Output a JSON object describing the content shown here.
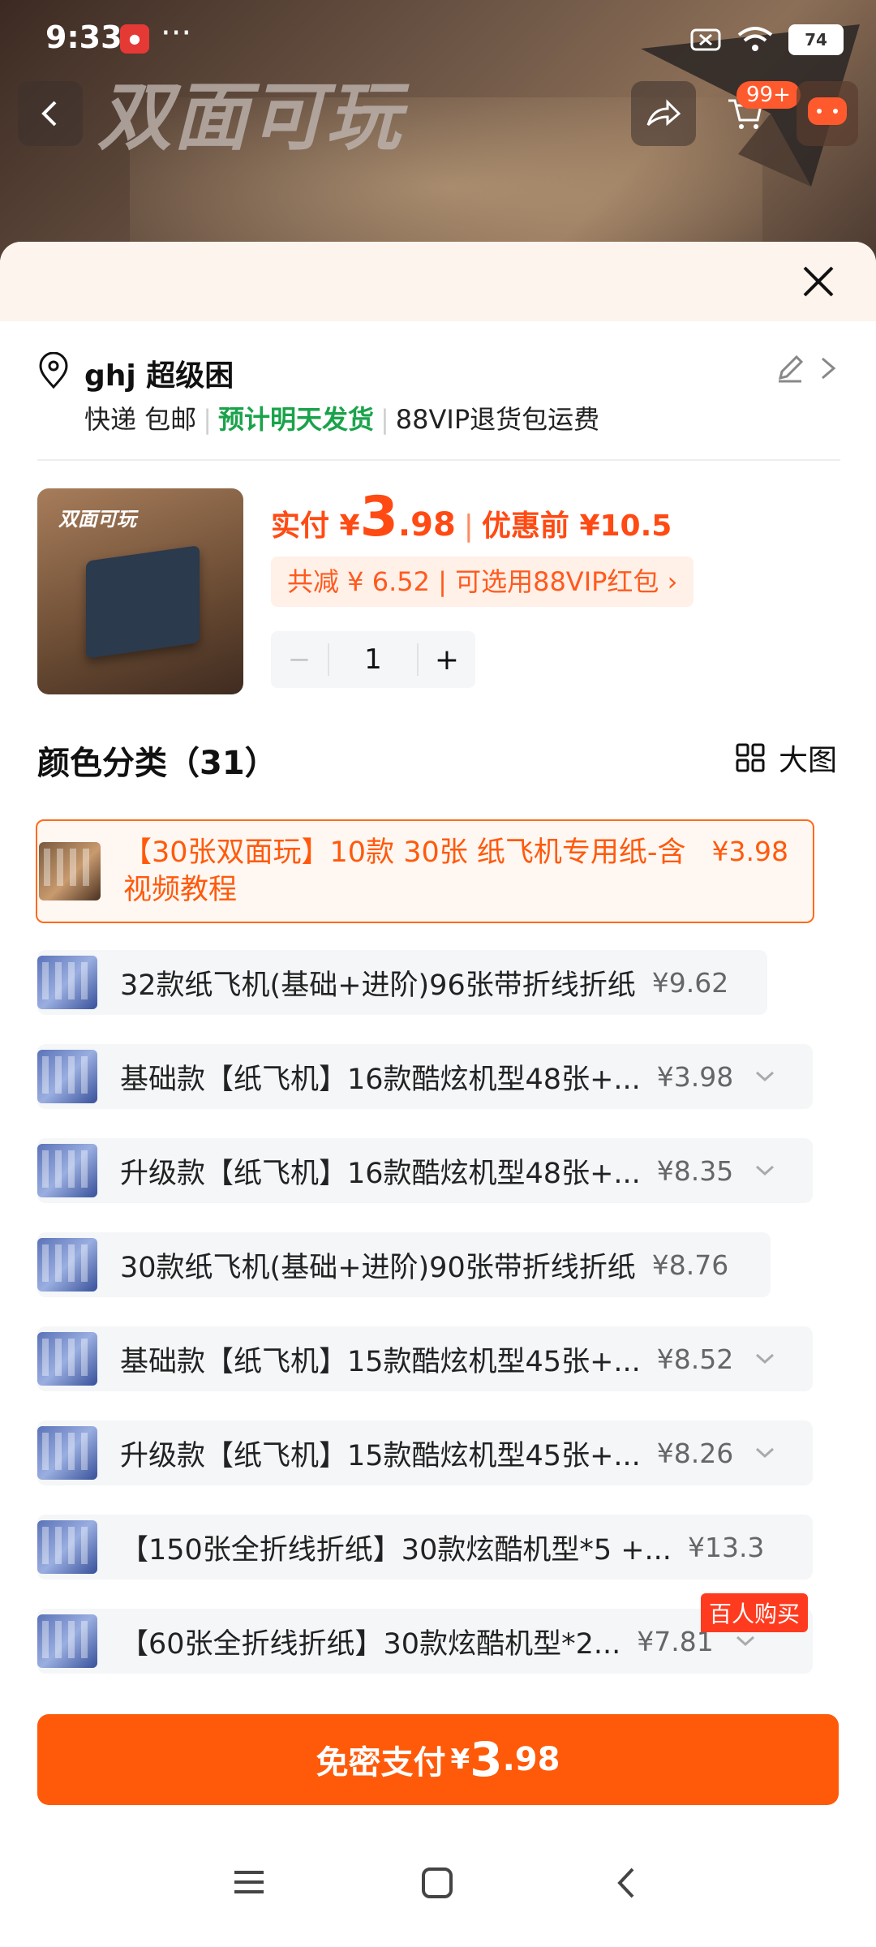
{
  "status_bar": {
    "time": "9:33",
    "more": "···",
    "battery": "74"
  },
  "hero": {
    "title": "双面可玩"
  },
  "top_nav": {
    "cart_badge": "99+"
  },
  "address": {
    "name": "ghj 超级困",
    "shipping": "快递 包邮",
    "ship_time": "预计明天发货",
    "return_note": "88VIP退货包运费"
  },
  "product": {
    "img_tag": "双面可玩",
    "paid_label": "实付 ¥",
    "price_int": "3",
    "price_dec": ".98",
    "before_label": "优惠前 ¥10.5",
    "discount_text": "共减 ¥ 6.52 | 可选用88VIP红包 ›",
    "quantity": "1",
    "minus": "−",
    "plus": "+"
  },
  "section": {
    "title": "颜色分类（31）",
    "big_image": "大图"
  },
  "options": [
    {
      "label": "【30张双面玩】10款 30张 纸飞机专用纸-含视频教程",
      "price": "¥3.98"
    },
    {
      "label": "32款纸飞机(基础+进阶)96张带折线折纸",
      "price": "¥9.62"
    },
    {
      "label": "基础款【纸飞机】16款酷炫机型48张+...",
      "price": "¥3.98"
    },
    {
      "label": "升级款【纸飞机】16款酷炫机型48张+...",
      "price": "¥8.35"
    },
    {
      "label": "30款纸飞机(基础+进阶)90张带折线折纸",
      "price": "¥8.76"
    },
    {
      "label": "基础款【纸飞机】15款酷炫机型45张+...",
      "price": "¥8.52"
    },
    {
      "label": "升级款【纸飞机】15款酷炫机型45张+...",
      "price": "¥8.26"
    },
    {
      "label": "【150张全折线折纸】30款炫酷机型*5 +...",
      "price": "¥13.3"
    },
    {
      "label": "【60张全折线折纸】30款炫酷机型*2...",
      "price": "¥7.81"
    }
  ],
  "hot_badge": "百人购买",
  "pay": {
    "label": "免密支付",
    "yen": "¥",
    "int": "3",
    "dec": ".98"
  },
  "colors": {
    "accent": "#ff5a0a",
    "green": "#1aa34a"
  }
}
